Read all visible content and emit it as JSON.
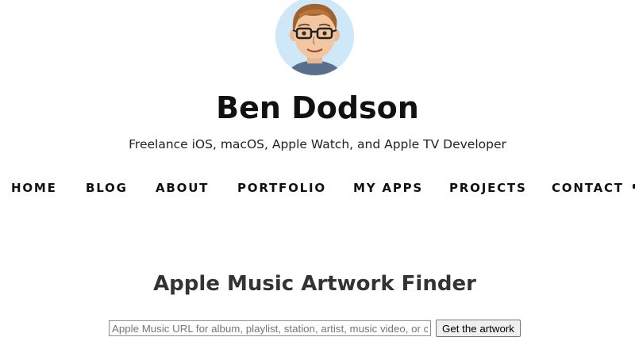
{
  "header": {
    "avatar_alt": "Ben Dodson avatar",
    "site_title": "Ben Dodson",
    "tagline": "Freelance iOS, macOS, Apple Watch, and Apple TV Developer"
  },
  "nav": {
    "items": [
      {
        "label": "HOME"
      },
      {
        "label": "BLOG"
      },
      {
        "label": "ABOUT"
      },
      {
        "label": "PORTFOLIO"
      },
      {
        "label": "MY APPS"
      },
      {
        "label": "PROJECTS"
      },
      {
        "label": "CONTACT"
      }
    ]
  },
  "main": {
    "heading": "Apple Music Artwork Finder",
    "url_input": {
      "placeholder": "Apple Music URL for album, playlist, station, artist, music video, or c",
      "value": ""
    },
    "submit_label": "Get the artwork"
  },
  "colors": {
    "text": "#111111",
    "heading": "#333333",
    "background": "#ffffff",
    "avatar_bg": "#cfe8f7"
  },
  "icons": {
    "avatar": "cartoon-face-with-glasses"
  }
}
